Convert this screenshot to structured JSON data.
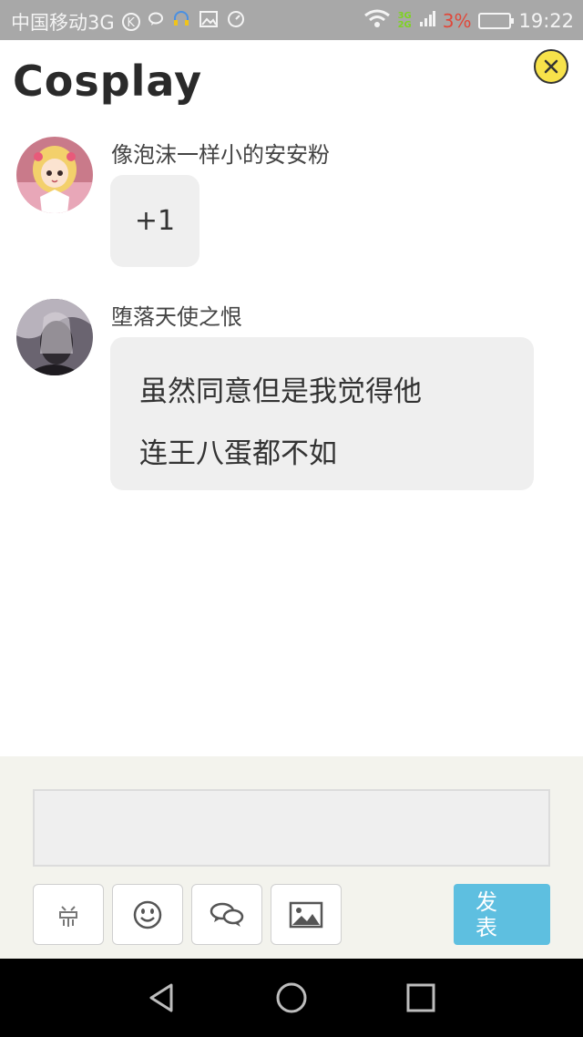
{
  "status_bar": {
    "carrier": "中国移动3G",
    "network_tag_top": "3G",
    "network_tag_bottom": "2G",
    "battery_percent": "3%",
    "time": "19:22"
  },
  "header": {
    "title": "Cosplay"
  },
  "messages": [
    {
      "username": "像泡沫一样小的安安粉",
      "text": "+1"
    },
    {
      "username": "堕落天使之恨",
      "text_line1": "虽然同意但是我觉得他",
      "text_line2": "连王八蛋都不如"
    }
  ],
  "composer": {
    "input_value": "",
    "tools": [
      "sticker-icon",
      "smiley-icon",
      "chat-bubbles-icon",
      "image-icon"
    ],
    "send_label_line1": "发",
    "send_label_line2": "表"
  },
  "colors": {
    "accent": "#5ebfe0",
    "close_button": "#f7e24a",
    "status_bar": "#a8a8a8",
    "bubble": "#efefef",
    "battery_low": "#e0483a"
  }
}
